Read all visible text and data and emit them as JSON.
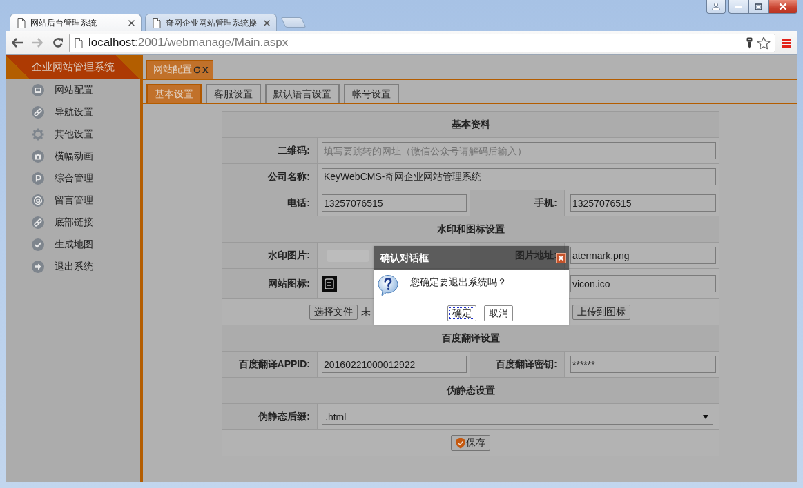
{
  "browser": {
    "tabs": [
      {
        "title": "网站后台管理系统",
        "selected": true
      },
      {
        "title": "奇网企业网站管理系统操",
        "selected": false
      }
    ],
    "navigation": [
      {
        "kind": "back",
        "disabled": false
      },
      {
        "kind": "forward",
        "disabled": true
      },
      {
        "kind": "reload",
        "disabled": false
      }
    ],
    "address": {
      "host": "localhost",
      "path": ":2001/webmanage/Main.aspx"
    }
  },
  "sidebar": {
    "title": "企业网站管理系统",
    "items": [
      "网站配置",
      "导航设置",
      "其他设置",
      "横幅动画",
      "综合管理",
      "留言管理",
      "底部链接",
      "生成地图",
      "退出系统"
    ]
  },
  "page_tabs": [
    {
      "label": "网站配置",
      "close": "X",
      "selected": true
    }
  ],
  "sub_tabs": [
    {
      "label": "基本设置",
      "selected": true
    },
    {
      "label": "客服设置",
      "selected": false
    },
    {
      "label": "默认语言设置",
      "selected": false
    },
    {
      "label": "帐号设置",
      "selected": false
    }
  ],
  "form": {
    "rows": [
      {
        "kind": "section",
        "title": "基本资料"
      },
      {
        "kind": "field",
        "label": "二维码:",
        "placeholder": "填写要跳转的网址（微信公众号请解码后输入）"
      },
      {
        "kind": "field",
        "label": "公司名称:",
        "value": "KeyWebCMS-奇网企业网站管理系统"
      },
      {
        "kind": "pair",
        "label": "电话:",
        "value": "13257076515",
        "label_2": "手机:",
        "value_2": "13257076515"
      },
      {
        "kind": "section",
        "title": "水印和图标设置"
      },
      {
        "kind": "image_pair",
        "label": "水印图片:",
        "label_2": "图片地址:",
        "value_2": "atermark.png"
      },
      {
        "kind": "icon_pair",
        "label": "网站图标:",
        "value_2": "vicon.ico"
      },
      {
        "kind": "upload",
        "button": "选择文件",
        "status": "未",
        "action": "上传到图标"
      },
      {
        "kind": "section",
        "title": "百度翻译设置"
      },
      {
        "kind": "pair",
        "label": "百度翻译APPID:",
        "value": "20160221000012922",
        "label_2": "百度翻译密钥:",
        "value_2": "******"
      },
      {
        "kind": "section",
        "title": "伪静态设置"
      },
      {
        "kind": "select",
        "label": "伪静态后缀:",
        "value": ".html"
      },
      {
        "kind": "submit",
        "button": "保存"
      }
    ]
  },
  "dialog": {
    "title": "确认对话框",
    "message": "您确定要退出系统吗？",
    "buttons": [
      {
        "label": "确定",
        "focused": true
      },
      {
        "label": "取消",
        "focused": false
      }
    ]
  }
}
